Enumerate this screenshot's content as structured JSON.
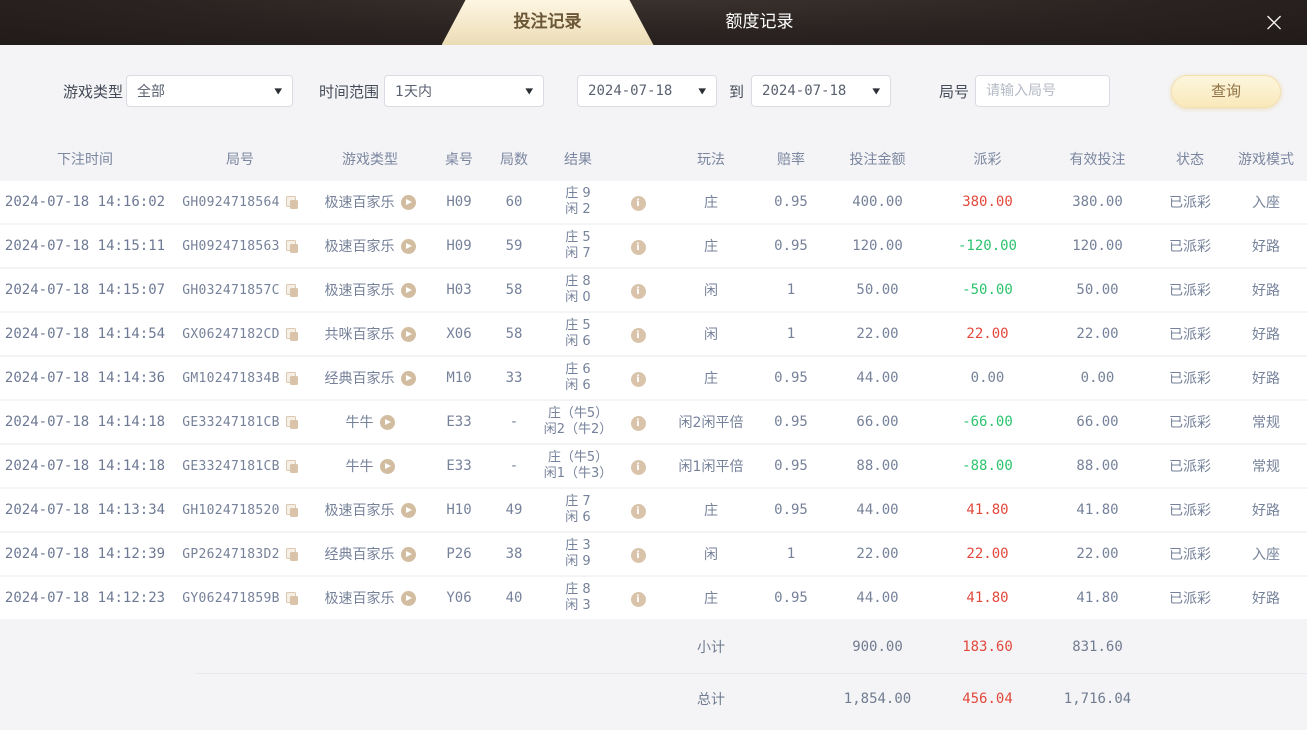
{
  "header": {
    "tabs": [
      {
        "label": "投注记录",
        "active": true
      },
      {
        "label": "额度记录",
        "active": false
      }
    ],
    "close_icon": "×"
  },
  "filters": {
    "game_type_label": "游戏类型",
    "game_type_value": "全部",
    "time_range_label": "时间范围",
    "time_range_value": "1天内",
    "date_from": "2024-07-18",
    "to_label": "到",
    "date_to": "2024-07-18",
    "round_label": "局号",
    "round_placeholder": "请输入局号",
    "search_button": "查询",
    "caret_icon": "▼"
  },
  "table": {
    "headers": [
      "下注时间",
      "局号",
      "游戏类型",
      "桌号",
      "局数",
      "结果",
      "玩法",
      "赔率",
      "投注金额",
      "派彩",
      "有效投注",
      "状态",
      "游戏模式"
    ],
    "info_icon_glyph": "i",
    "rows": [
      {
        "time": "2024-07-18 14:16:02",
        "round_id": "GH0924718564",
        "game_type": "极速百家乐",
        "table_no": "H09",
        "round_count": "60",
        "result_line1": "庄 9",
        "result_line2": "闲 2",
        "play": "庄",
        "odds": "0.95",
        "bet_amount": "400.00",
        "payout": "380.00",
        "payout_color": "red",
        "valid_bet": "380.00",
        "status": "已派彩",
        "mode": "入座"
      },
      {
        "time": "2024-07-18 14:15:11",
        "round_id": "GH0924718563",
        "game_type": "极速百家乐",
        "table_no": "H09",
        "round_count": "59",
        "result_line1": "庄 5",
        "result_line2": "闲 7",
        "play": "庄",
        "odds": "0.95",
        "bet_amount": "120.00",
        "payout": "-120.00",
        "payout_color": "green",
        "valid_bet": "120.00",
        "status": "已派彩",
        "mode": "好路"
      },
      {
        "time": "2024-07-18 14:15:07",
        "round_id": "GH032471857C",
        "game_type": "极速百家乐",
        "table_no": "H03",
        "round_count": "58",
        "result_line1": "庄 8",
        "result_line2": "闲 0",
        "play": "闲",
        "odds": "1",
        "bet_amount": "50.00",
        "payout": "-50.00",
        "payout_color": "green",
        "valid_bet": "50.00",
        "status": "已派彩",
        "mode": "好路"
      },
      {
        "time": "2024-07-18 14:14:54",
        "round_id": "GX06247182CD",
        "game_type": "共咪百家乐",
        "table_no": "X06",
        "round_count": "58",
        "result_line1": "庄 5",
        "result_line2": "闲 6",
        "play": "闲",
        "odds": "1",
        "bet_amount": "22.00",
        "payout": "22.00",
        "payout_color": "red",
        "valid_bet": "22.00",
        "status": "已派彩",
        "mode": "好路"
      },
      {
        "time": "2024-07-18 14:14:36",
        "round_id": "GM102471834B",
        "game_type": "经典百家乐",
        "table_no": "M10",
        "round_count": "33",
        "result_line1": "庄 6",
        "result_line2": "闲 6",
        "play": "庄",
        "odds": "0.95",
        "bet_amount": "44.00",
        "payout": "0.00",
        "payout_color": "gray",
        "valid_bet": "0.00",
        "status": "已派彩",
        "mode": "好路"
      },
      {
        "time": "2024-07-18 14:14:18",
        "round_id": "GE33247181CB",
        "game_type": "牛牛",
        "table_no": "E33",
        "round_count": "-",
        "result_line1": "庄（牛5）",
        "result_line2": "闲2（牛2）",
        "play": "闲2闲平倍",
        "odds": "0.95",
        "bet_amount": "66.00",
        "payout": "-66.00",
        "payout_color": "green",
        "valid_bet": "66.00",
        "status": "已派彩",
        "mode": "常规"
      },
      {
        "time": "2024-07-18 14:14:18",
        "round_id": "GE33247181CB",
        "game_type": "牛牛",
        "table_no": "E33",
        "round_count": "-",
        "result_line1": "庄（牛5）",
        "result_line2": "闲1（牛3）",
        "play": "闲1闲平倍",
        "odds": "0.95",
        "bet_amount": "88.00",
        "payout": "-88.00",
        "payout_color": "green",
        "valid_bet": "88.00",
        "status": "已派彩",
        "mode": "常规"
      },
      {
        "time": "2024-07-18 14:13:34",
        "round_id": "GH1024718520",
        "game_type": "极速百家乐",
        "table_no": "H10",
        "round_count": "49",
        "result_line1": "庄 7",
        "result_line2": "闲 6",
        "play": "庄",
        "odds": "0.95",
        "bet_amount": "44.00",
        "payout": "41.80",
        "payout_color": "red",
        "valid_bet": "41.80",
        "status": "已派彩",
        "mode": "好路"
      },
      {
        "time": "2024-07-18 14:12:39",
        "round_id": "GP26247183D2",
        "game_type": "经典百家乐",
        "table_no": "P26",
        "round_count": "38",
        "result_line1": "庄 3",
        "result_line2": "闲 9",
        "play": "闲",
        "odds": "1",
        "bet_amount": "22.00",
        "payout": "22.00",
        "payout_color": "red",
        "valid_bet": "22.00",
        "status": "已派彩",
        "mode": "入座"
      },
      {
        "time": "2024-07-18 14:12:23",
        "round_id": "GY062471859B",
        "game_type": "极速百家乐",
        "table_no": "Y06",
        "round_count": "40",
        "result_line1": "庄 8",
        "result_line2": "闲 3",
        "play": "庄",
        "odds": "0.95",
        "bet_amount": "44.00",
        "payout": "41.80",
        "payout_color": "red",
        "valid_bet": "41.80",
        "status": "已派彩",
        "mode": "好路"
      }
    ],
    "summary": [
      {
        "label": "小计",
        "bet_amount": "900.00",
        "payout": "183.60",
        "payout_color": "red",
        "valid_bet": "831.60"
      },
      {
        "label": "总计",
        "bet_amount": "1,854.00",
        "payout": "456.04",
        "payout_color": "red",
        "valid_bet": "1,716.04"
      }
    ]
  },
  "colors": {
    "accent_gold": "#f0ddb0",
    "positive_red": "#e2493d",
    "negative_green": "#2cc46e",
    "topbar_dark": "#2a2321",
    "panel_gray": "#f4f4f6"
  }
}
